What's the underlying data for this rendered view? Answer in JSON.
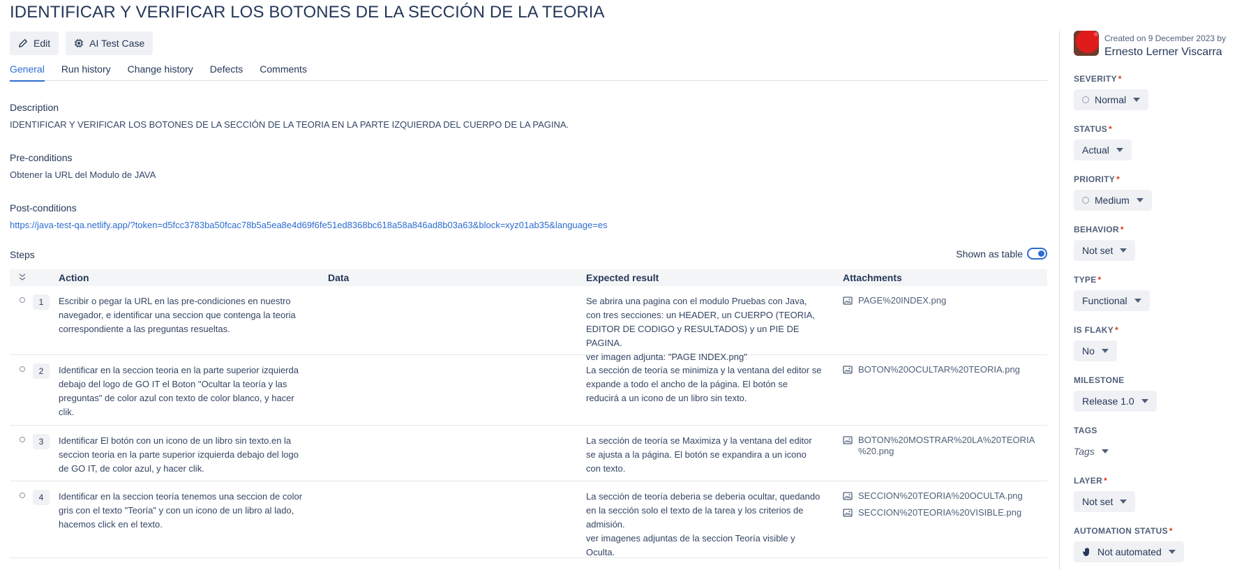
{
  "header": {
    "title": "IDENTIFICAR Y VERIFICAR LOS BOTONES DE LA SECCIÓN DE LA TEORIA",
    "edit_label": "Edit",
    "ai_label": "AI Test Case"
  },
  "tabs": [
    {
      "label": "General"
    },
    {
      "label": "Run history"
    },
    {
      "label": "Change history"
    },
    {
      "label": "Defects"
    },
    {
      "label": "Comments"
    }
  ],
  "sections": {
    "description_label": "Description",
    "description_text": "IDENTIFICAR Y VERIFICAR LOS BOTONES DE LA SECCIÓN DE LA TEORIA EN LA PARTE IZQUIERDA DEL CUERPO DE LA PAGINA.",
    "pre_label": "Pre-conditions",
    "pre_text": "Obtener la URL del Modulo de JAVA",
    "post_label": "Post-conditions",
    "post_link": "https://java-test-qa.netlify.app/?token=d5fcc3783ba50fcac78b5a5ea8e4d69f6fe51ed8368bc618a58a846ad8b03a63&block=xyz01ab35&language=es",
    "steps_label": "Steps",
    "shown_as_table": "Shown as table"
  },
  "table": {
    "headers": {
      "action": "Action",
      "data": "Data",
      "expected": "Expected result",
      "attachments": "Attachments"
    },
    "rows": [
      {
        "num": "1",
        "action": [
          "Escribir o pegar la URL en las pre-condiciones en nuestro",
          "navegador, e identificar una seccion que contenga la teoria",
          "correspondiente a las preguntas resueltas."
        ],
        "data": "",
        "expected": [
          "Se abrira una pagina con el modulo Pruebas con Java,",
          "con tres secciones: un HEADER, un CUERPO (TEORIA,",
          "EDITOR DE CODIGO y RESULTADOS) y un PIE DE PAGINA.",
          "ver imagen adjunta: \"PAGE INDEX.png\""
        ],
        "attachments": [
          "PAGE%20INDEX.png"
        ]
      },
      {
        "num": "2",
        "action": [
          "Identificar en la seccion teoria en la parte superior izquierda",
          "debajo del logo de GO IT el Boton \"Ocultar la teoría y las",
          "preguntas\" de color azul con texto de color blanco, y hacer",
          "clik."
        ],
        "data": "",
        "expected": [
          "La sección de teoría se minimiza y la ventana del editor se",
          "expande a todo el ancho de la página. El botón se",
          "reducirá a un icono de un libro sin texto."
        ],
        "attachments": [
          "BOTON%20OCULTAR%20TEORIA.png"
        ]
      },
      {
        "num": "3",
        "action": [
          "Identificar El botón con un icono de un libro sin texto.en la",
          "seccion teoria en la parte superior izquierda debajo del logo",
          "de GO IT, de color azul, y hacer clik."
        ],
        "data": "",
        "expected": [
          "La sección de teoría se Maximiza y la ventana del editor",
          "se ajusta a la página. El botón se expandira a un icono",
          "con texto."
        ],
        "attachments": [
          "BOTON%20MOSTRAR%20LA%20TEORIA\n%20.png"
        ]
      },
      {
        "num": "4",
        "action": [
          "Identificar en la seccion teoría tenemos una seccion de color",
          "gris con el texto \"Teoría\" y con un icono de un libro al lado,",
          "hacemos click en el texto."
        ],
        "data": "",
        "expected": [
          "La sección de teoría deberia se deberia ocultar, quedando",
          "en la sección solo el texto de la tarea y los criterios de",
          "admisión.",
          "ver imagenes adjuntas de la seccion Teoría visible y",
          "Oculta."
        ],
        "attachments": [
          "SECCION%20TEORIA%20OCULTA.png",
          "SECCION%20TEORIA%20VISIBLE.png"
        ]
      }
    ]
  },
  "sidebar": {
    "created_on": "Created on 9 December 2023 by",
    "created_by": "Ernesto Lerner Viscarra",
    "fields": {
      "severity": {
        "label": "SEVERITY",
        "value": "Normal"
      },
      "status": {
        "label": "STATUS",
        "value": "Actual"
      },
      "priority": {
        "label": "PRIORITY",
        "value": "Medium"
      },
      "behavior": {
        "label": "BEHAVIOR",
        "value": "Not set"
      },
      "type": {
        "label": "TYPE",
        "value": "Functional"
      },
      "is_flaky": {
        "label": "IS FLAKY",
        "value": "No"
      },
      "milestone": {
        "label": "MILESTONE",
        "value": "Release 1.0"
      },
      "tags": {
        "label": "TAGS",
        "value": "Tags"
      },
      "layer": {
        "label": "LAYER",
        "value": "Not set"
      },
      "automation_status": {
        "label": "AUTOMATION STATUS",
        "value": "Not automated"
      }
    },
    "required_mark": "*"
  },
  "colors": {
    "accent": "#2b6cd2",
    "required": "#de350b",
    "text": "#253858"
  }
}
